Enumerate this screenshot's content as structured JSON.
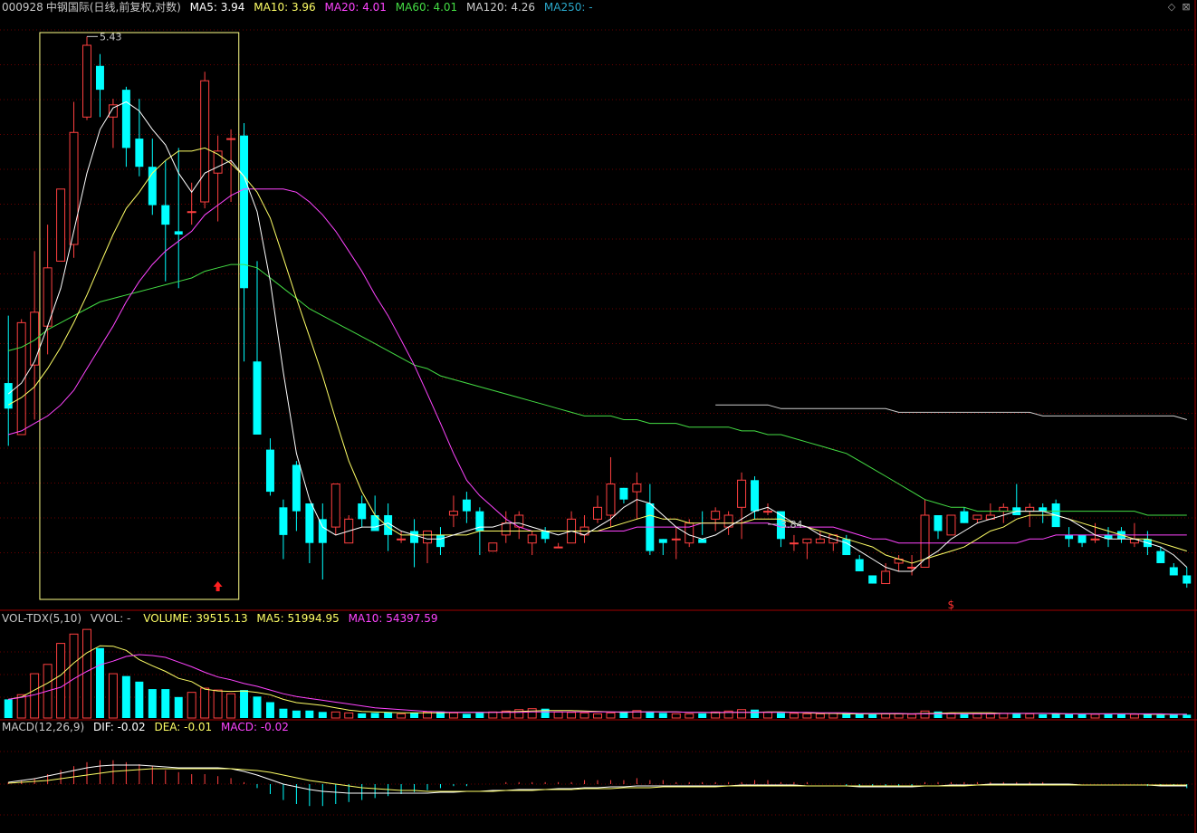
{
  "header": {
    "code": "000928",
    "name": "中钢国际",
    "mode": "(日线,前复权,对数)",
    "ma5": "MA5: 3.94",
    "ma10": "MA10: 3.96",
    "ma20": "MA20: 4.01",
    "ma60": "MA60: 4.01",
    "ma120": "MA120: 4.26",
    "ma250": "MA250: -"
  },
  "price_markers": {
    "high": "5.43",
    "low": "3.84",
    "signal": "$"
  },
  "volume_panel": {
    "name": "VOL-TDX(5,10)",
    "vvol": "VVOL: -",
    "volume": "VOLUME: 39515.13",
    "ma5": "MA5: 51994.95",
    "ma10": "MA10: 54397.59"
  },
  "macd_panel": {
    "name": "MACD(12,26,9)",
    "dif": "DIF: -0.02",
    "dea": "DEA: -0.01",
    "macd": "MACD: -0.02"
  },
  "colors": {
    "up": "#ff4040",
    "down": "#00ffff",
    "ma5": "#ffffff",
    "ma10": "#ffff66",
    "ma20": "#ff44ff",
    "ma60": "#44dd44",
    "ma120": "#cccccc",
    "ma250": "#2aa7c9",
    "grid": "#6a0000",
    "highlight_box": "#ffff88"
  },
  "chart_data": {
    "type": "candlestick",
    "ohlc": [
      [
        4.36,
        4.55,
        4.19,
        4.29
      ],
      [
        4.22,
        4.54,
        4.22,
        4.53
      ],
      [
        4.41,
        4.74,
        4.26,
        4.56
      ],
      [
        4.52,
        4.82,
        4.44,
        4.69
      ],
      [
        4.71,
        4.93,
        4.71,
        4.93
      ],
      [
        4.76,
        5.21,
        4.72,
        5.11
      ],
      [
        5.16,
        5.43,
        5.15,
        5.4
      ],
      [
        5.33,
        5.37,
        5.16,
        5.25
      ],
      [
        5.16,
        5.22,
        5.06,
        5.2
      ],
      [
        5.25,
        5.26,
        5.0,
        5.06
      ],
      [
        5.09,
        5.22,
        4.97,
        5.0
      ],
      [
        5.0,
        5.09,
        4.85,
        4.88
      ],
      [
        4.88,
        5.02,
        4.65,
        4.82
      ],
      [
        4.8,
        5.06,
        4.63,
        4.79
      ],
      [
        4.86,
        4.95,
        4.82,
        4.86
      ],
      [
        4.89,
        5.31,
        4.87,
        5.28
      ],
      [
        4.98,
        5.1,
        4.83,
        5.05
      ],
      [
        5.09,
        5.12,
        4.89,
        5.09
      ],
      [
        5.1,
        5.14,
        4.42,
        4.63
      ],
      [
        4.42,
        4.71,
        4.25,
        4.22
      ],
      [
        4.18,
        4.21,
        4.06,
        4.07
      ],
      [
        4.03,
        4.05,
        3.9,
        3.96
      ],
      [
        4.14,
        4.15,
        3.97,
        4.02
      ],
      [
        4.04,
        4.04,
        3.89,
        3.94
      ],
      [
        4.0,
        4.04,
        3.85,
        3.94
      ],
      [
        3.98,
        4.08,
        3.96,
        4.09
      ],
      [
        3.94,
        4.01,
        3.94,
        4.0
      ],
      [
        4.04,
        4.06,
        3.98,
        4.0
      ],
      [
        4.01,
        4.06,
        3.99,
        3.97
      ],
      [
        4.01,
        4.04,
        3.92,
        3.96
      ],
      [
        3.95,
        3.97,
        3.94,
        3.95
      ],
      [
        3.97,
        4.0,
        3.88,
        3.94
      ],
      [
        3.94,
        3.97,
        3.89,
        3.97
      ],
      [
        3.96,
        3.98,
        3.91,
        3.93
      ],
      [
        4.01,
        4.06,
        3.98,
        4.02
      ],
      [
        4.05,
        4.07,
        3.99,
        4.02
      ],
      [
        4.02,
        4.03,
        3.91,
        3.97
      ],
      [
        3.92,
        3.94,
        3.92,
        3.94
      ],
      [
        3.96,
        4.02,
        3.94,
        3.99
      ],
      [
        3.98,
        4.02,
        3.95,
        4.01
      ],
      [
        3.94,
        3.97,
        3.91,
        3.96
      ],
      [
        3.97,
        3.98,
        3.94,
        3.95
      ],
      [
        3.93,
        3.94,
        3.93,
        3.93
      ],
      [
        3.94,
        4.02,
        3.94,
        4.0
      ],
      [
        3.96,
        4.01,
        3.94,
        3.98
      ],
      [
        4.0,
        4.06,
        3.99,
        4.03
      ],
      [
        4.01,
        4.16,
        3.98,
        4.09
      ],
      [
        4.08,
        4.08,
        4.04,
        4.05
      ],
      [
        4.07,
        4.12,
        4.0,
        4.09
      ],
      [
        4.04,
        4.09,
        3.91,
        3.92
      ],
      [
        3.95,
        3.95,
        3.91,
        3.94
      ],
      [
        3.95,
        3.98,
        3.9,
        3.95
      ],
      [
        3.94,
        4.0,
        3.93,
        3.99
      ],
      [
        3.95,
        4.02,
        3.96,
        3.94
      ],
      [
        4.0,
        4.03,
        3.97,
        4.02
      ],
      [
        3.98,
        4.02,
        3.96,
        4.01
      ],
      [
        4.03,
        4.12,
        3.95,
        4.1
      ],
      [
        4.1,
        4.11,
        4.0,
        4.02
      ],
      [
        4.02,
        4.04,
        4.01,
        4.02
      ],
      [
        4.02,
        4.02,
        3.93,
        3.95
      ],
      [
        3.94,
        3.96,
        3.92,
        3.94
      ],
      [
        3.94,
        3.94,
        3.9,
        3.95
      ],
      [
        3.94,
        3.97,
        3.94,
        3.95
      ],
      [
        3.94,
        3.96,
        3.92,
        3.96
      ],
      [
        3.95,
        3.96,
        3.91,
        3.91
      ],
      [
        3.9,
        3.91,
        3.87,
        3.87
      ],
      [
        3.86,
        3.86,
        3.84,
        3.84
      ],
      [
        3.84,
        3.89,
        3.84,
        3.87
      ],
      [
        3.89,
        3.91,
        3.87,
        3.9
      ],
      [
        3.88,
        3.91,
        3.86,
        3.88
      ],
      [
        3.88,
        4.05,
        3.88,
        4.01
      ],
      [
        4.01,
        4.01,
        3.95,
        3.97
      ],
      [
        3.96,
        4.01,
        3.96,
        4.01
      ],
      [
        4.02,
        4.03,
        3.99,
        3.99
      ],
      [
        4.0,
        4.01,
        3.99,
        4.01
      ],
      [
        4.0,
        4.04,
        4.0,
        4.01
      ],
      [
        4.02,
        4.04,
        3.99,
        4.03
      ],
      [
        4.03,
        4.09,
        4.01,
        4.01
      ],
      [
        4.02,
        4.04,
        3.98,
        4.03
      ],
      [
        4.03,
        4.04,
        3.99,
        4.02
      ],
      [
        4.04,
        4.05,
        3.99,
        3.98
      ],
      [
        3.96,
        3.98,
        3.93,
        3.95
      ],
      [
        3.96,
        3.96,
        3.93,
        3.94
      ],
      [
        3.95,
        3.99,
        3.94,
        3.95
      ],
      [
        3.96,
        3.98,
        3.93,
        3.95
      ],
      [
        3.97,
        3.98,
        3.94,
        3.95
      ],
      [
        3.94,
        3.99,
        3.93,
        3.95
      ],
      [
        3.95,
        3.97,
        3.91,
        3.93
      ],
      [
        3.92,
        3.93,
        3.89,
        3.89
      ],
      [
        3.88,
        3.89,
        3.86,
        3.86
      ],
      [
        3.86,
        3.88,
        3.83,
        3.84
      ]
    ],
    "ma_lines": {
      "ma5": [
        4.33,
        4.36,
        4.42,
        4.52,
        4.63,
        4.8,
        4.98,
        5.12,
        5.19,
        5.21,
        5.18,
        5.12,
        5.07,
        4.98,
        4.92,
        4.98,
        5.0,
        5.02,
        4.97,
        4.86,
        4.65,
        4.39,
        4.17,
        4.05,
        3.98,
        3.96,
        3.97,
        3.98,
        3.98,
        3.99,
        3.97,
        3.96,
        3.95,
        3.95,
        3.96,
        3.97,
        3.98,
        3.98,
        3.99,
        3.99,
        3.98,
        3.97,
        3.96,
        3.97,
        3.96,
        3.98,
        4.0,
        4.03,
        4.05,
        4.04,
        4.01,
        3.98,
        3.96,
        3.95,
        3.96,
        3.98,
        4.0,
        4.02,
        4.03,
        4.01,
        3.99,
        3.98,
        3.96,
        3.95,
        3.94,
        3.92,
        3.9,
        3.88,
        3.87,
        3.87,
        3.9,
        3.92,
        3.95,
        3.97,
        3.99,
        4.0,
        4.01,
        4.02,
        4.02,
        4.02,
        4.01,
        4.0,
        3.98,
        3.96,
        3.95,
        3.95,
        3.95,
        3.94,
        3.93,
        3.91,
        3.88
      ],
      "ma10": [
        4.3,
        4.32,
        4.35,
        4.4,
        4.46,
        4.53,
        4.61,
        4.7,
        4.79,
        4.87,
        4.92,
        4.98,
        5.02,
        5.05,
        5.05,
        5.06,
        5.04,
        5.01,
        4.97,
        4.92,
        4.84,
        4.72,
        4.6,
        4.49,
        4.38,
        4.26,
        4.15,
        4.07,
        4.01,
        3.98,
        3.96,
        3.96,
        3.96,
        3.96,
        3.96,
        3.96,
        3.97,
        3.97,
        3.97,
        3.97,
        3.97,
        3.97,
        3.97,
        3.97,
        3.97,
        3.97,
        3.98,
        3.99,
        4.0,
        4.01,
        4.0,
        4.0,
        3.99,
        3.99,
        3.99,
        3.99,
        3.99,
        4.0,
        4.0,
        4.0,
        3.99,
        3.98,
        3.97,
        3.96,
        3.95,
        3.94,
        3.93,
        3.91,
        3.9,
        3.89,
        3.9,
        3.91,
        3.92,
        3.93,
        3.95,
        3.97,
        3.98,
        4.0,
        4.01,
        4.01,
        4.01,
        4.0,
        3.99,
        3.98,
        3.97,
        3.96,
        3.95,
        3.95,
        3.94,
        3.93,
        3.92
      ],
      "ma20": [
        4.22,
        4.23,
        4.25,
        4.27,
        4.3,
        4.34,
        4.4,
        4.46,
        4.52,
        4.59,
        4.65,
        4.7,
        4.74,
        4.77,
        4.8,
        4.85,
        4.88,
        4.91,
        4.93,
        4.93,
        4.93,
        4.93,
        4.92,
        4.89,
        4.85,
        4.8,
        4.74,
        4.68,
        4.61,
        4.55,
        4.48,
        4.41,
        4.33,
        4.25,
        4.17,
        4.1,
        4.06,
        4.03,
        4.0,
        3.98,
        3.97,
        3.97,
        3.97,
        3.97,
        3.97,
        3.97,
        3.97,
        3.97,
        3.98,
        3.98,
        3.98,
        3.98,
        3.98,
        3.99,
        3.99,
        3.99,
        3.99,
        3.99,
        3.99,
        3.98,
        3.98,
        3.98,
        3.98,
        3.98,
        3.97,
        3.96,
        3.95,
        3.95,
        3.94,
        3.94,
        3.94,
        3.94,
        3.94,
        3.94,
        3.94,
        3.94,
        3.94,
        3.94,
        3.95,
        3.95,
        3.96,
        3.96,
        3.96,
        3.96,
        3.96,
        3.96,
        3.96,
        3.96,
        3.96,
        3.96,
        3.96
      ],
      "ma60": [
        4.45,
        4.46,
        4.48,
        4.51,
        4.53,
        4.55,
        4.57,
        4.59,
        4.6,
        4.61,
        4.62,
        4.63,
        4.64,
        4.65,
        4.66,
        4.68,
        4.69,
        4.7,
        4.7,
        4.69,
        4.66,
        4.63,
        4.6,
        4.57,
        4.55,
        4.53,
        4.51,
        4.49,
        4.47,
        4.45,
        4.43,
        4.41,
        4.4,
        4.38,
        4.37,
        4.36,
        4.35,
        4.34,
        4.33,
        4.32,
        4.31,
        4.3,
        4.29,
        4.28,
        4.27,
        4.27,
        4.27,
        4.26,
        4.26,
        4.25,
        4.25,
        4.25,
        4.24,
        4.24,
        4.24,
        4.24,
        4.23,
        4.23,
        4.22,
        4.22,
        4.21,
        4.2,
        4.19,
        4.18,
        4.17,
        4.15,
        4.13,
        4.11,
        4.09,
        4.07,
        4.05,
        4.04,
        4.03,
        4.03,
        4.02,
        4.02,
        4.02,
        4.02,
        4.02,
        4.02,
        4.02,
        4.02,
        4.02,
        4.02,
        4.02,
        4.02,
        4.02,
        4.01,
        4.01,
        4.01,
        4.01
      ],
      "ma120_start": 54,
      "ma120": [
        4.3,
        4.3,
        4.3,
        4.3,
        4.3,
        4.29,
        4.29,
        4.29,
        4.29,
        4.29,
        4.29,
        4.29,
        4.29,
        4.29,
        4.28,
        4.28,
        4.28,
        4.28,
        4.28,
        4.28,
        4.28,
        4.28,
        4.28,
        4.28,
        4.28,
        4.27,
        4.27,
        4.27,
        4.27,
        4.27,
        4.27,
        4.27,
        4.27,
        4.27,
        4.27,
        4.27,
        4.26
      ]
    },
    "volume": [
      40,
      50,
      95,
      115,
      160,
      180,
      190,
      150,
      95,
      90,
      78,
      62,
      62,
      45,
      55,
      64,
      60,
      52,
      60,
      46,
      34,
      20,
      16,
      16,
      13,
      13,
      11,
      10,
      11,
      12,
      9,
      11,
      13,
      14,
      11,
      9,
      11,
      13,
      15,
      18,
      20,
      20,
      13,
      12,
      11,
      9,
      11,
      14,
      16,
      14,
      11,
      9,
      9,
      10,
      13,
      15,
      18,
      18,
      12,
      11,
      10,
      9,
      9,
      10,
      10,
      9,
      8,
      9,
      9,
      8,
      15,
      14,
      10,
      9,
      9,
      9,
      10,
      9,
      9,
      8,
      9,
      9,
      8,
      8,
      9,
      9,
      8,
      8,
      7,
      7,
      7
    ],
    "vol_ma5": [
      40,
      45,
      60,
      75,
      92,
      118,
      140,
      155,
      154,
      145,
      125,
      112,
      100,
      85,
      78,
      62,
      58,
      57,
      58,
      55,
      50,
      40,
      33,
      30,
      27,
      22,
      17,
      14,
      13,
      12,
      11,
      11,
      11,
      11,
      12,
      12,
      12,
      12,
      13,
      14,
      15,
      16,
      16,
      16,
      15,
      14,
      13,
      12,
      13,
      13,
      13,
      13,
      12,
      12,
      11,
      12,
      12,
      12,
      13,
      13,
      12,
      11,
      10,
      10,
      9,
      9,
      9,
      9,
      9,
      9,
      10,
      10,
      11,
      11,
      11,
      11,
      10,
      10,
      10,
      10,
      9,
      9,
      9,
      9,
      9,
      9,
      9,
      8,
      8,
      8,
      8
    ],
    "vol_ma10": [
      40,
      44,
      50,
      58,
      66,
      84,
      100,
      114,
      122,
      132,
      136,
      134,
      130,
      120,
      110,
      98,
      88,
      82,
      74,
      68,
      60,
      52,
      46,
      42,
      38,
      34,
      30,
      26,
      22,
      20,
      18,
      16,
      14,
      13,
      12,
      12,
      12,
      12,
      12,
      12,
      13,
      13,
      13,
      13,
      13,
      13,
      13,
      13,
      13,
      13,
      13,
      13,
      12,
      12,
      12,
      12,
      12,
      12,
      12,
      12,
      12,
      12,
      11,
      11,
      11,
      10,
      10,
      10,
      10,
      9,
      9,
      9,
      9,
      9,
      9,
      9,
      10,
      10,
      10,
      10,
      10,
      9,
      9,
      9,
      9,
      9,
      9,
      9,
      9,
      8,
      8
    ],
    "macd_hist": [
      0.01,
      0.02,
      0.03,
      0.05,
      0.07,
      0.09,
      0.11,
      0.12,
      0.12,
      0.11,
      0.1,
      0.09,
      0.07,
      0.06,
      0.05,
      0.05,
      0.04,
      0.03,
      0.01,
      -0.02,
      -0.05,
      -0.08,
      -0.1,
      -0.11,
      -0.11,
      -0.1,
      -0.09,
      -0.08,
      -0.07,
      -0.06,
      -0.05,
      -0.04,
      -0.03,
      -0.02,
      -0.01,
      -0.01,
      0.0,
      0.0,
      0.01,
      0.01,
      0.01,
      0.01,
      0.01,
      0.01,
      0.02,
      0.02,
      0.02,
      0.02,
      0.03,
      0.02,
      0.02,
      0.01,
      0.01,
      0.01,
      0.01,
      0.01,
      0.01,
      0.02,
      0.02,
      0.01,
      0.01,
      0.01,
      0.0,
      0.0,
      -0.01,
      -0.01,
      -0.01,
      -0.01,
      -0.01,
      -0.01,
      0.01,
      0.01,
      0.01,
      0.01,
      0.01,
      0.01,
      0.01,
      0.01,
      0.01,
      0.01,
      0.0,
      0.0,
      0.0,
      0.0,
      0.0,
      0.0,
      0.0,
      -0.01,
      -0.01,
      -0.01,
      -0.02
    ],
    "dif": [
      0.02,
      0.04,
      0.06,
      0.09,
      0.12,
      0.15,
      0.18,
      0.2,
      0.21,
      0.21,
      0.21,
      0.2,
      0.19,
      0.18,
      0.18,
      0.18,
      0.18,
      0.17,
      0.14,
      0.1,
      0.05,
      0.0,
      -0.03,
      -0.06,
      -0.08,
      -0.09,
      -0.1,
      -0.1,
      -0.1,
      -0.1,
      -0.1,
      -0.1,
      -0.1,
      -0.09,
      -0.09,
      -0.08,
      -0.08,
      -0.07,
      -0.07,
      -0.06,
      -0.06,
      -0.06,
      -0.05,
      -0.05,
      -0.04,
      -0.04,
      -0.03,
      -0.03,
      -0.02,
      -0.02,
      -0.02,
      -0.02,
      -0.02,
      -0.02,
      -0.02,
      -0.02,
      -0.01,
      -0.01,
      -0.01,
      -0.01,
      -0.01,
      -0.02,
      -0.02,
      -0.02,
      -0.02,
      -0.03,
      -0.03,
      -0.03,
      -0.03,
      -0.03,
      -0.02,
      -0.02,
      -0.01,
      -0.01,
      -0.01,
      0.0,
      0.0,
      0.0,
      0.0,
      0.0,
      0.0,
      0.0,
      -0.01,
      -0.01,
      -0.01,
      -0.01,
      -0.01,
      -0.01,
      -0.02,
      -0.02,
      -0.02
    ],
    "dea": [
      0.01,
      0.02,
      0.03,
      0.04,
      0.06,
      0.08,
      0.1,
      0.12,
      0.14,
      0.15,
      0.16,
      0.17,
      0.17,
      0.17,
      0.17,
      0.17,
      0.17,
      0.17,
      0.16,
      0.15,
      0.13,
      0.1,
      0.07,
      0.04,
      0.02,
      0.0,
      -0.02,
      -0.04,
      -0.05,
      -0.06,
      -0.07,
      -0.07,
      -0.08,
      -0.08,
      -0.08,
      -0.08,
      -0.08,
      -0.08,
      -0.07,
      -0.07,
      -0.07,
      -0.06,
      -0.06,
      -0.06,
      -0.05,
      -0.05,
      -0.05,
      -0.04,
      -0.04,
      -0.04,
      -0.03,
      -0.03,
      -0.03,
      -0.03,
      -0.03,
      -0.02,
      -0.02,
      -0.02,
      -0.02,
      -0.02,
      -0.02,
      -0.02,
      -0.02,
      -0.02,
      -0.02,
      -0.02,
      -0.02,
      -0.02,
      -0.02,
      -0.02,
      -0.02,
      -0.02,
      -0.02,
      -0.02,
      -0.01,
      -0.01,
      -0.01,
      -0.01,
      -0.01,
      -0.01,
      -0.01,
      -0.01,
      -0.01,
      -0.01,
      -0.01,
      -0.01,
      -0.01,
      -0.01,
      -0.01,
      -0.01,
      -0.01
    ],
    "price_range": [
      3.78,
      5.5
    ],
    "log_scale": true,
    "highlight_range": [
      3,
      17
    ],
    "signal_arrow_index": 16,
    "signal_dollar_index": 72,
    "high_index": 6,
    "low_index": 58
  }
}
